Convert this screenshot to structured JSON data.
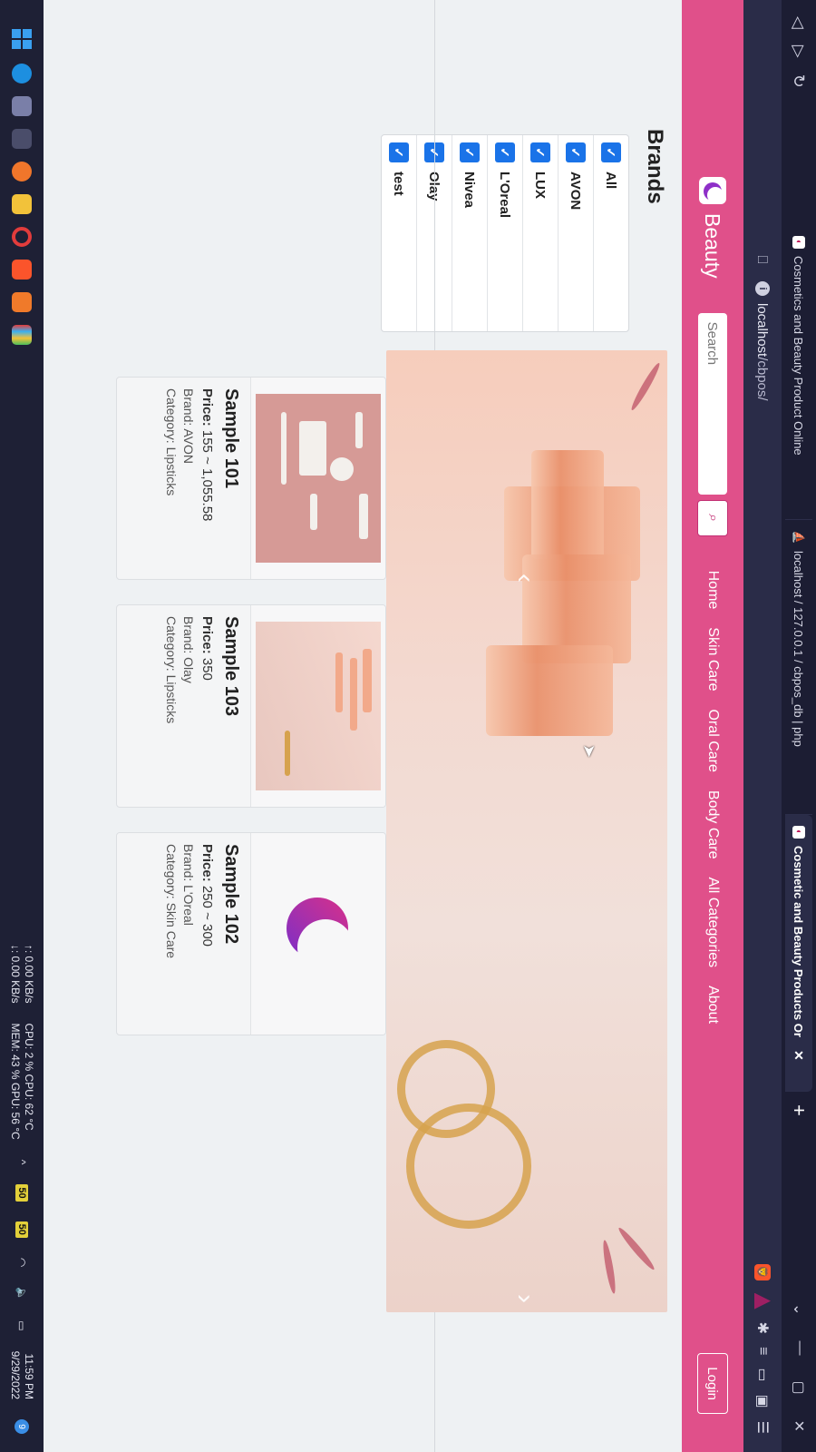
{
  "browser": {
    "tabs": [
      {
        "title": "Cosmetics and Beauty Product Online",
        "icon": "site-favicon",
        "active": false
      },
      {
        "title": "localhost / 127.0.0.1 / cbpos_db | php",
        "icon": "phpmyadmin-favicon",
        "active": false
      },
      {
        "title": "Cosmetic and Beauty Products Or",
        "icon": "site-favicon",
        "active": true
      }
    ],
    "new_tab_symbol": "+",
    "address": {
      "host": "localhost",
      "path": "/cbpos/"
    }
  },
  "site": {
    "brand": "Beauty",
    "search_placeholder": "Search",
    "menu": [
      "Home",
      "Skin Care",
      "Oral Care",
      "Body Care",
      "All Categories",
      "About"
    ],
    "login_label": "Login"
  },
  "brands": {
    "title": "Brands",
    "items": [
      "All",
      "AVON",
      "LUX",
      "L'Oreal",
      "Nivea",
      "Olay",
      "test"
    ],
    "checked": true
  },
  "products": [
    {
      "name": "Sample 101",
      "price_label": "Price:",
      "price": "155 ~ 1,055.58",
      "brand": "Brand: AVON",
      "category": "Category: Lipsticks"
    },
    {
      "name": "Sample 103",
      "price_label": "Price:",
      "price": "350",
      "brand": "Brand: Olay",
      "category": "Category: Lipsticks"
    },
    {
      "name": "Sample 102",
      "price_label": "Price:",
      "price": "250 ~ 300",
      "brand": "Brand: L'Oreal",
      "category": "Category: Skin Care"
    }
  ],
  "taskbar": {
    "net_up": "↑: 0.00 KB/s",
    "net_down": "↓: 0.00 KB/s",
    "cpu_line": "CPU: 2 %   CPU: 62 °C",
    "mem_line": "MEM: 43 % GPU: 56 °C",
    "badge_a": "50",
    "badge_b": "50",
    "time": "11:59 PM",
    "date": "9/29/2022",
    "notifications": "9"
  },
  "colors": {
    "nav_pink": "#e0508a",
    "checkbox_blue": "#1a73e8"
  }
}
